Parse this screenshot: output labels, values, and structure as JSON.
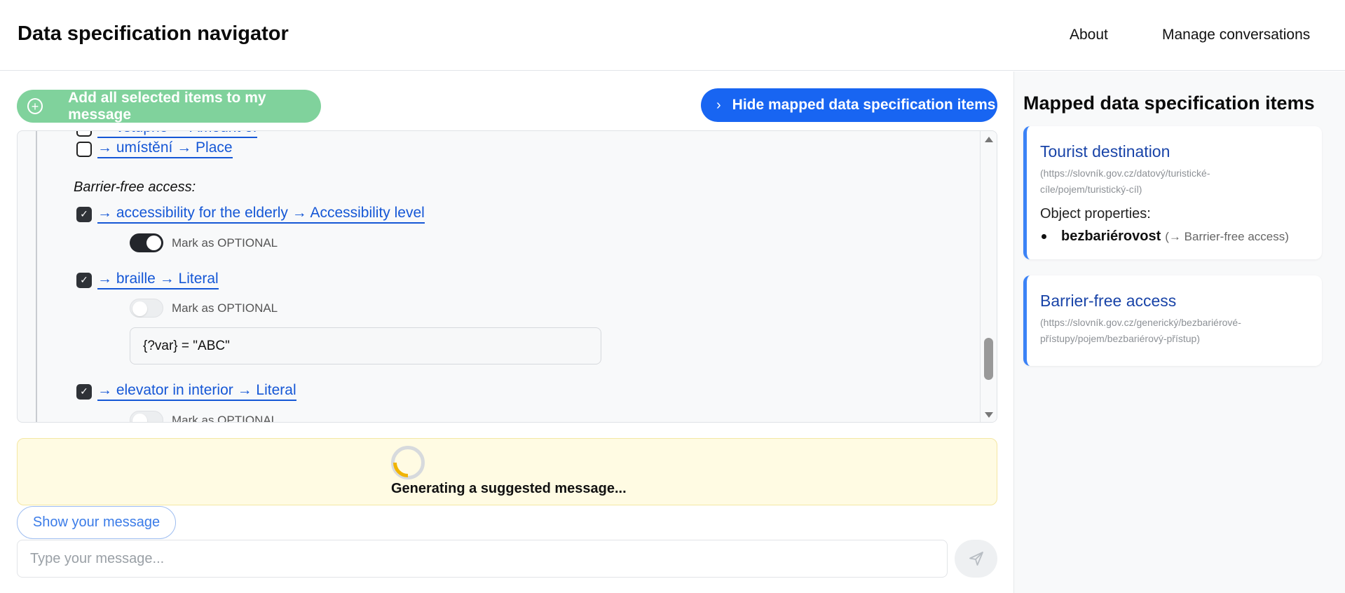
{
  "header": {
    "title": "Data specification navigator",
    "nav": {
      "about": "About",
      "manage": "Manage conversations"
    }
  },
  "toolbar": {
    "add_selected_label": "Add all selected items to my message",
    "hide_mapped_label": "Hide mapped data specification items"
  },
  "panel": {
    "top_partial_item": "→ vstupné → Amount of",
    "items_before": [
      {
        "label": "→ umístění → Place",
        "checked": false
      }
    ],
    "section_title": "Barrier-free access:",
    "items": [
      {
        "label": "→ accessibility for the elderly → Accessibility level",
        "checked": true,
        "optional_label": "Mark as OPTIONAL",
        "optional": true
      },
      {
        "label": "→ braille → Literal",
        "checked": true,
        "optional_label": "Mark as OPTIONAL",
        "optional": false,
        "filter_value": "{?var} = \"ABC\""
      },
      {
        "label": "→ elevator in interior → Literal",
        "checked": true,
        "optional_label": "Mark as OPTIONAL",
        "optional": false
      }
    ]
  },
  "status": {
    "text": "Generating a suggested message..."
  },
  "composer": {
    "show_message_label": "Show your message",
    "placeholder": "Type your message..."
  },
  "sidebar": {
    "title": "Mapped data specification items",
    "cards": [
      {
        "title": "Tourist destination",
        "url": "(https://slovník.gov.cz/datový/turistické-cíle/pojem/turistický-cíl)",
        "subheading": "Object properties:",
        "properties": [
          {
            "name": "bezbariérovost",
            "ref": "(→ Barrier-free access)"
          }
        ]
      },
      {
        "title": "Barrier-free access",
        "url": "(https://slovník.gov.cz/generický/bezbariérové-přístupy/pojem/bezbariérový-přístup)"
      }
    ]
  },
  "colors": {
    "primary": "#1865f2",
    "success_disabled": "#80d29c",
    "link": "#1557d6",
    "card_accent": "#3b82f6",
    "status_bg": "#fffbe3",
    "spinner_arc": "#f0b400"
  },
  "icons": {
    "add": "plus-circle-icon",
    "hide": "chevron-right-icon",
    "check": "check-icon",
    "send": "paper-plane-icon",
    "spinner": "spinner-icon"
  }
}
